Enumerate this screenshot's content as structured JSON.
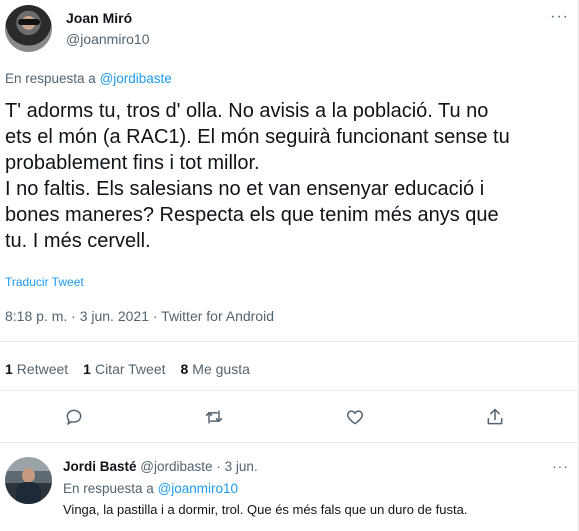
{
  "tweet": {
    "author_name": "Joan Miró",
    "author_handle": "@joanmiro10",
    "reply_prefix": "En respuesta a ",
    "reply_to": "@jordibaste",
    "text": "T' adorms tu, tros d' olla. No avisis a la població. Tu no\nets el món (a RAC1). El món seguirà funcionant sense tu\nprobablement fins i tot millor.\nI no faltis. Els salesians no et van ensenyar educació i\nbones maneres? Respecta els que tenim més anys que\ntu. I més cervell.",
    "translate_label": "Traducir Tweet",
    "meta": "8:18 p. m. · 3 jun. 2021 · Twitter for Android",
    "stats": {
      "retweets_count": "1",
      "retweets_label": "Retweet",
      "quotes_count": "1",
      "quotes_label": "Citar Tweet",
      "likes_count": "8",
      "likes_label": "Me gusta"
    },
    "icons": [
      "reply-icon",
      "retweet-icon",
      "like-icon",
      "share-icon"
    ]
  },
  "reply": {
    "author_name": "Jordi Basté",
    "author_handle": "@jordibaste",
    "time": "3 jun.",
    "reply_prefix": "En respuesta a ",
    "reply_to": "@joanmiro10",
    "text": "Vinga, la pastilla i a dormir, trol. Que és més fals que un duro de fusta."
  },
  "colors": {
    "accent": "#1d9bf0",
    "secondary_text": "#536471",
    "primary_text": "#0f1419",
    "divider": "#e6ecf0"
  }
}
